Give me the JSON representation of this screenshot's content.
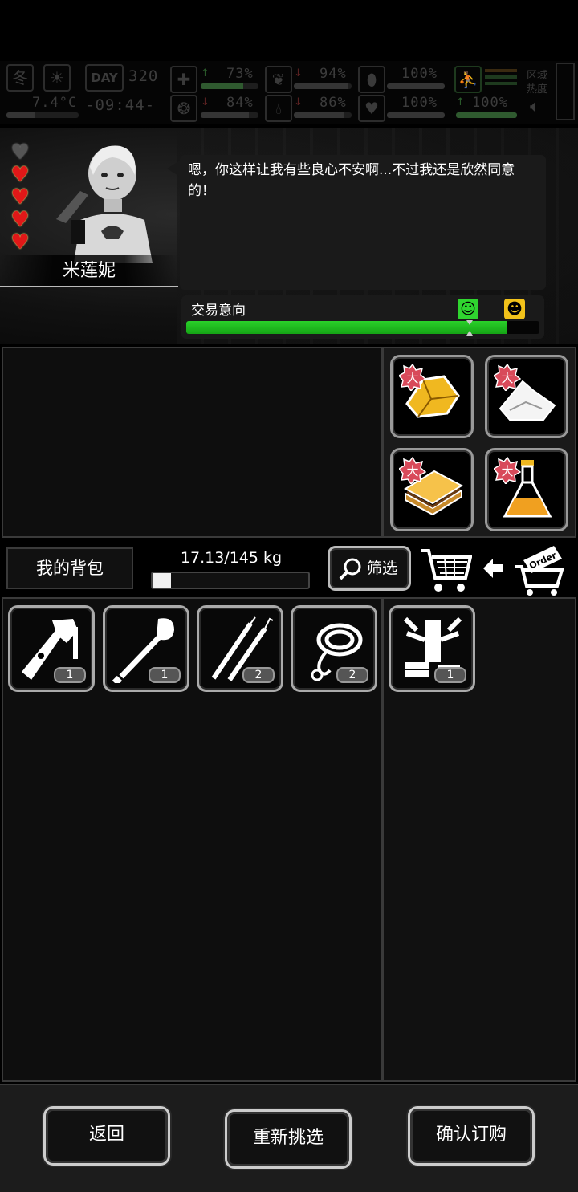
{
  "status": {
    "season": "冬",
    "temperature": "7.4°C",
    "day_label": "DAY",
    "day_number": "320",
    "time": "-09:44-",
    "health": "73%",
    "hunger": "94%",
    "stamina": "100%",
    "mood": "84%",
    "thirst": "86%",
    "vitality": "100%",
    "energy": "100%",
    "area_heat_label": "区域\n热度",
    "health_level": 0.73,
    "hunger_level": 0.94,
    "stamina_level": 1.0,
    "mood_level": 0.84,
    "thirst_level": 0.86,
    "vitality_level": 1.0,
    "energy_level": 1.0
  },
  "npc": {
    "name": "米莲妮",
    "hearts_filled": 4,
    "hearts_total": 5,
    "dialog": "嗯，你这样让我有些良心不安啊...不过我还是欣然同意的！"
  },
  "trade": {
    "label": "交易意向",
    "level": 0.91
  },
  "categories": [
    {
      "name": "gold-ore-icon",
      "badge": "大"
    },
    {
      "name": "salt-pile-icon",
      "badge": "大"
    },
    {
      "name": "sandwich-icon",
      "badge": "大"
    },
    {
      "name": "potion-flask-icon",
      "badge": "大"
    }
  ],
  "toolbar": {
    "bag_label": "我的背包",
    "weight": "17.13/145 kg",
    "weight_level": 0.118,
    "filter_label": "筛选",
    "order_tag": "Order"
  },
  "bag_items": [
    {
      "name": "multitool-icon",
      "qty": "1"
    },
    {
      "name": "shovel-icon",
      "qty": "1"
    },
    {
      "name": "lockpick-icon",
      "qty": "2"
    },
    {
      "name": "rope-icon",
      "qty": "2"
    }
  ],
  "selected_items": [
    {
      "name": "weapon-parts-icon",
      "qty": "1"
    }
  ],
  "footer": {
    "back": "返回",
    "reselect": "重新挑选",
    "confirm": "确认订购"
  },
  "colors": {
    "trade_bar": "#22c022",
    "heart": "#e01818",
    "badge": "#d84a5a"
  }
}
